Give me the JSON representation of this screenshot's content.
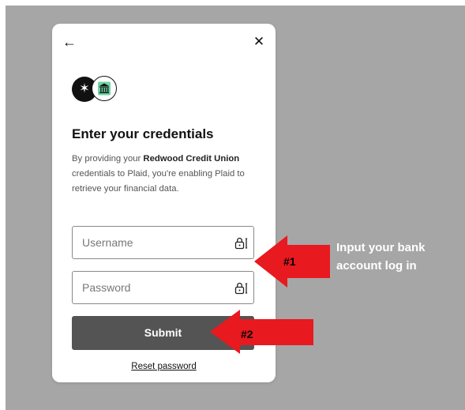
{
  "modal": {
    "back_icon": "arrow-left-icon",
    "close_icon": "close-icon",
    "logos": [
      "plaid-logo-icon",
      "bank-icon"
    ],
    "title": "Enter your credentials",
    "description": {
      "prefix": "By providing your ",
      "institution": "Redwood Credit Union",
      "suffix": " credentials to Plaid, you're enabling Plaid to retrieve your financial data."
    },
    "username": {
      "placeholder": "Username",
      "value": ""
    },
    "password": {
      "placeholder": "Password",
      "value": ""
    },
    "submit_label": "Submit",
    "reset_label": "Reset password"
  },
  "annotations": {
    "arrow1_label": "#1",
    "arrow2_label": "#2",
    "note": "Input your bank account log in",
    "arrow_color": "#e8191f"
  },
  "colors": {
    "backdrop": "#a6a6a6",
    "button": "#545454"
  }
}
